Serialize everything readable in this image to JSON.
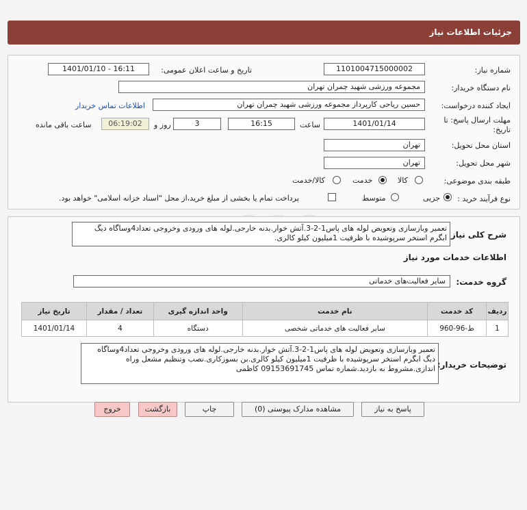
{
  "header": {
    "title": "جزئیات اطلاعات نیاز"
  },
  "need_number": {
    "label": "شماره نیاز:",
    "value": "1101004715000002"
  },
  "announce": {
    "label": "تاریخ و ساعت اعلان عمومی:",
    "value": "1401/01/10 - 16:11"
  },
  "buyer_org": {
    "label": "نام دستگاه خریدار:",
    "value": "مجموعه ورزشی شهید چمران تهران"
  },
  "requester": {
    "label": "ایجاد کننده درخواست:",
    "value": "حسین ریاحی کارپرداز مجموعه ورزشی شهید چمران تهران",
    "contact_link": "اطلاعات تماس خریدار"
  },
  "deadline": {
    "label_line1": "مهلت ارسال پاسخ: تا",
    "label_line2": "تاریخ:",
    "date": "1401/01/14",
    "time_label": "ساعت",
    "time": "16:15",
    "days": "3",
    "days_label": "روز و",
    "remaining": "06:19:02",
    "remaining_label": "ساعت باقی مانده"
  },
  "province": {
    "label": "استان محل تحویل:",
    "value": "تهران"
  },
  "city": {
    "label": "شهر محل تحویل:",
    "value": "تهران"
  },
  "category": {
    "label": "طبقه بندی موضوعی:",
    "options": [
      "کالا",
      "خدمت",
      "کالا/خدمت"
    ],
    "selected": "خدمت"
  },
  "purchase_type": {
    "label": "نوع فرآیند خرید :",
    "options": [
      "جزیی",
      "متوسط"
    ],
    "selected": "جزیی",
    "payment_note": "پرداخت تمام یا بخشی از مبلغ خرید،از محل \"اسناد خزانه اسلامی\" خواهد بود."
  },
  "summary": {
    "label": "شرح کلی نیاز:",
    "text": "تعمیر وبازسازی وتعویض لوله های پاس1-2-3.آتش خوار.بدنه خارجی.لوله های ورودی وخروجی تعداد4وساگاه دیگ ابگرم استخر سرپوشیده با ظرفیت 1میلیون کیلو کالری."
  },
  "services_title": "اطلاعات خدمات مورد نیاز",
  "service_group": {
    "label": "گروه خدمت:",
    "value": "سایر فعالیت‌های خدماتی"
  },
  "table": {
    "headers": [
      "ردیف",
      "کد خدمت",
      "نام خدمت",
      "واحد اندازه گیری",
      "تعداد / مقدار",
      "تاریخ نیاز"
    ],
    "rows": [
      [
        "1",
        "ط-96-960",
        "سایر فعالیت های خدماتی شخصی",
        "دستگاه",
        "4",
        "1401/01/14"
      ]
    ]
  },
  "buyer_notes": {
    "label": "توضیحات خریدار:",
    "text": "تعمیر وبازسازی وتعویض لوله های پاس1-2-3.آتش خوار.بدنه خارجی.لوله های ورودی وخروجی تعداد4وساگاه دیگ ابگرم استخر سرپوشیده با ظرفیت 1میلیون کیلو کالری.بن بسوزکاری.نصب وتنظیم مشعل وراه اندازی.مشروط به بازدید.شماره تماس 09153691745 کاظمی"
  },
  "buttons": {
    "reply": "پاسخ به نیاز",
    "docs": "مشاهده مدارک پیوستی (0)",
    "print": "چاپ",
    "back": "بازگشت",
    "exit": "خروج"
  },
  "colors": {
    "header": "#8b3f37",
    "link": "#1a4fb8",
    "exit_button": "#f5c7c7"
  }
}
